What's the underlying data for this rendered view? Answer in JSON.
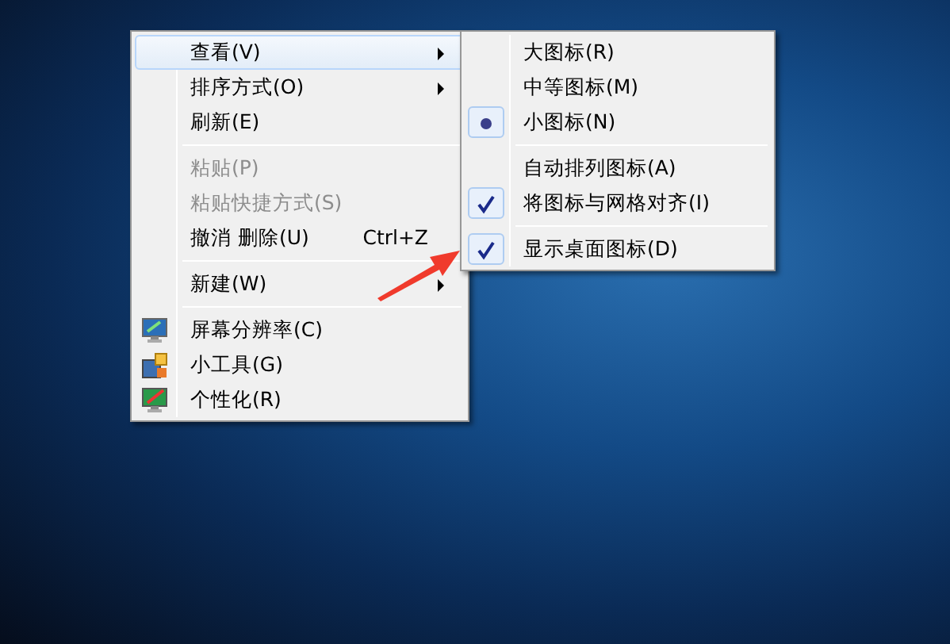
{
  "context_menu": {
    "items": [
      {
        "kind": "item",
        "label": "查看(V)",
        "has_submenu": true,
        "selected": true,
        "disabled": false
      },
      {
        "kind": "item",
        "label": "排序方式(O)",
        "has_submenu": true,
        "selected": false,
        "disabled": false
      },
      {
        "kind": "item",
        "label": "刷新(E)",
        "has_submenu": false,
        "selected": false,
        "disabled": false
      },
      {
        "kind": "separator"
      },
      {
        "kind": "item",
        "label": "粘贴(P)",
        "has_submenu": false,
        "selected": false,
        "disabled": true
      },
      {
        "kind": "item",
        "label": "粘贴快捷方式(S)",
        "has_submenu": false,
        "selected": false,
        "disabled": true
      },
      {
        "kind": "item",
        "label": "撤消 删除(U)",
        "shortcut": "Ctrl+Z",
        "has_submenu": false,
        "selected": false,
        "disabled": false
      },
      {
        "kind": "separator"
      },
      {
        "kind": "item",
        "label": "新建(W)",
        "has_submenu": true,
        "selected": false,
        "disabled": false
      },
      {
        "kind": "separator"
      },
      {
        "kind": "display",
        "label": "屏幕分辨率(C)",
        "has_submenu": false,
        "selected": false,
        "disabled": false
      },
      {
        "kind": "gadget",
        "label": "小工具(G)",
        "has_submenu": false,
        "selected": false,
        "disabled": false
      },
      {
        "kind": "personalize",
        "label": "个性化(R)",
        "has_submenu": false,
        "selected": false,
        "disabled": false
      }
    ]
  },
  "submenu": {
    "items": [
      {
        "kind": "radio",
        "label": "大图标(R)",
        "checked": false
      },
      {
        "kind": "radio",
        "label": "中等图标(M)",
        "checked": false
      },
      {
        "kind": "radio",
        "label": "小图标(N)",
        "checked": true
      },
      {
        "kind": "separator"
      },
      {
        "kind": "check",
        "label": "自动排列图标(A)",
        "checked": false
      },
      {
        "kind": "check",
        "label": "将图标与网格对齐(I)",
        "checked": true
      },
      {
        "kind": "separator"
      },
      {
        "kind": "check",
        "label": "显示桌面图标(D)",
        "checked": true
      }
    ]
  }
}
